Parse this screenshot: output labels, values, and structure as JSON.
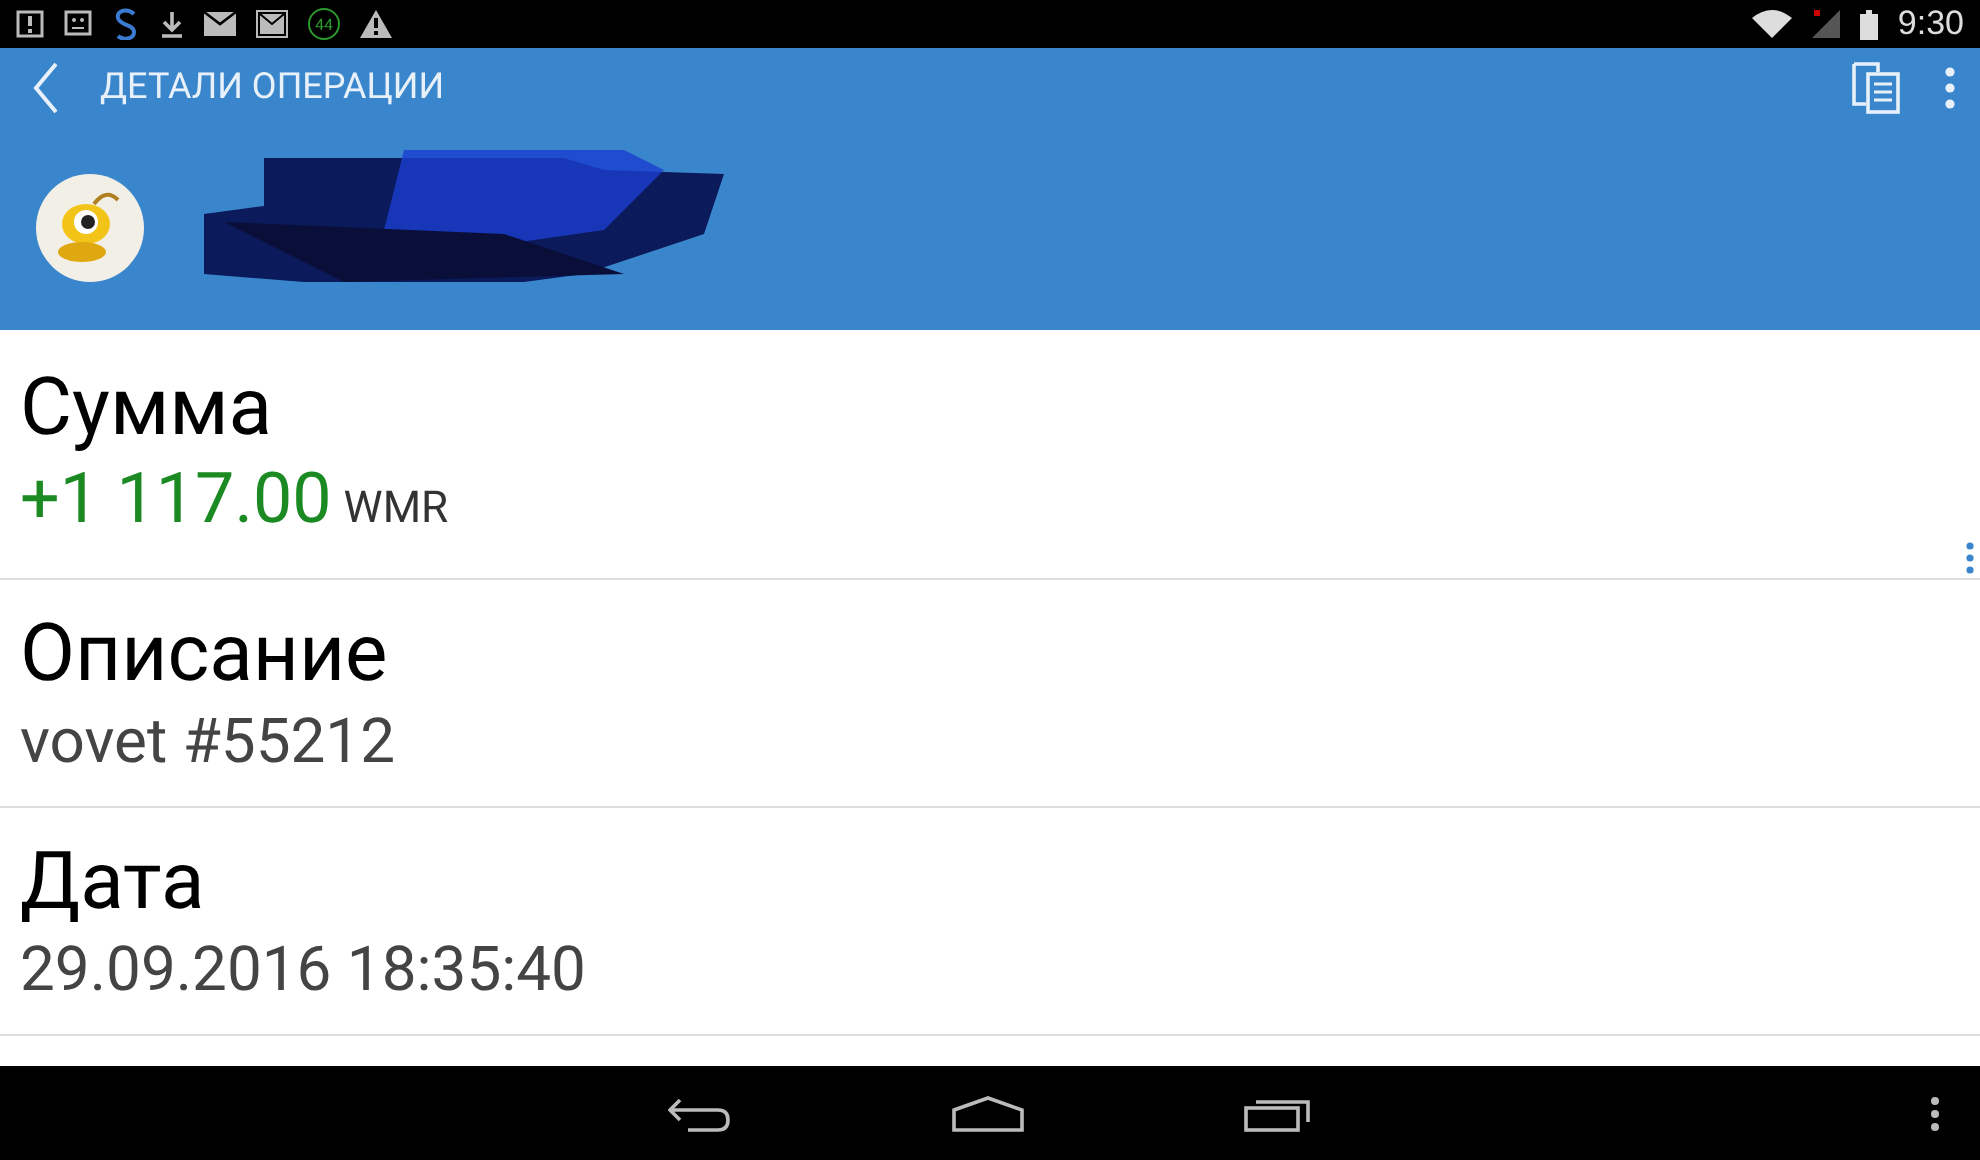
{
  "status_bar": {
    "time": "9:30",
    "notification_badge": "44"
  },
  "app_bar": {
    "title": "ДЕТАЛИ ОПЕРАЦИИ"
  },
  "account": {
    "kind": "redacted"
  },
  "fields": [
    {
      "kind": "amount",
      "label": "Сумма",
      "value": "+1 117.00",
      "unit": "WMR"
    },
    {
      "kind": "text",
      "label": "Описание",
      "value": "vovet #55212"
    },
    {
      "kind": "text",
      "label": "Дата",
      "value": "29.09.2016 18:35:40"
    }
  ]
}
